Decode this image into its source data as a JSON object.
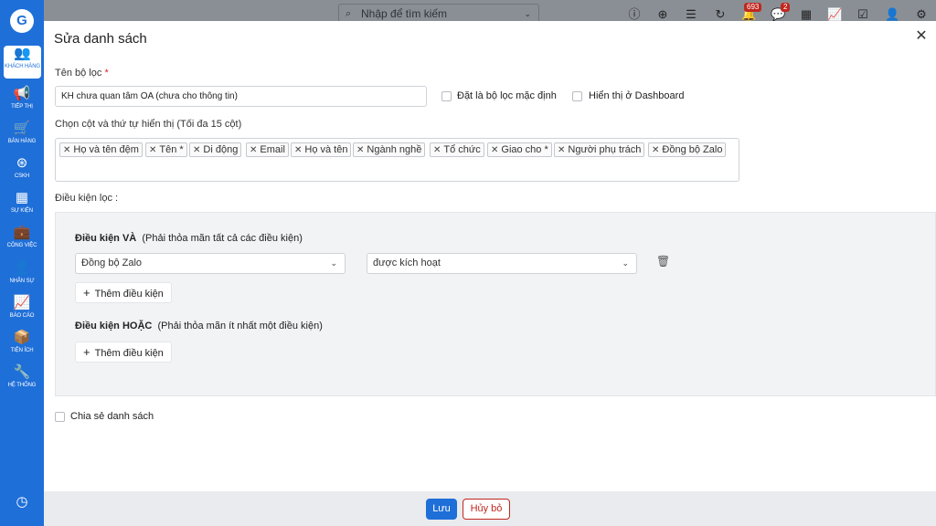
{
  "sidebar": {
    "logo": "G",
    "items": [
      {
        "label": "KHÁCH HÀNG",
        "icon": "users-icon",
        "glyph": "👥"
      },
      {
        "label": "TIẾP THỊ",
        "icon": "megaphone-icon",
        "glyph": "📢"
      },
      {
        "label": "BÁN HÀNG",
        "icon": "cart-icon",
        "glyph": "🛒"
      },
      {
        "label": "CSKH",
        "icon": "lifebuoy-icon",
        "glyph": "⊛"
      },
      {
        "label": "SỰ KIỆN",
        "icon": "calendar-icon",
        "glyph": "▦"
      },
      {
        "label": "CÔNG VIỆC",
        "icon": "briefcase-icon",
        "glyph": "💼"
      },
      {
        "label": "NHÂN SỰ",
        "icon": "person-icon",
        "glyph": "👤"
      },
      {
        "label": "BÁO CÁO",
        "icon": "report-icon",
        "glyph": "📈"
      },
      {
        "label": "TIỆN ÍCH",
        "icon": "boxes-icon",
        "glyph": "📦"
      },
      {
        "label": "HỆ THỐNG",
        "icon": "wrench-icon",
        "glyph": "🔧"
      }
    ],
    "clock_glyph": "◷"
  },
  "topbar": {
    "search_placeholder": "Nhập để tìm kiếm",
    "notifications_badge": "693",
    "messages_badge": "2"
  },
  "modal": {
    "title": "Sửa danh sách",
    "close_glyph": "✕",
    "filter_name_label": "Tên bộ lọc",
    "required_mark": "*",
    "filter_name_value": "KH chưa quan tâm OA (chưa cho thông tin)",
    "default_filter_label": "Đặt là bộ lọc mặc định",
    "dashboard_label": "Hiển thị ở Dashboard",
    "columns_label": "Chọn cột và thứ tự hiển thị (Tối đa 15 cột)",
    "columns": [
      "Họ và tên đệm",
      "Tên *",
      "Di động",
      "Email",
      "Họ và tên",
      "Ngành nghề",
      "Tổ chức",
      "Giao cho *",
      "Người phụ trách",
      "Đồng bộ Zalo"
    ],
    "conditions_label": "Điều kiện lọc :",
    "and_group": {
      "title": "Điều kiện VÀ",
      "hint": "(Phải thỏa mãn tất cả các điều kiện)",
      "field": "Đồng bộ Zalo",
      "value": "được kích hoạt",
      "add_label": "Thêm điều kiện"
    },
    "or_group": {
      "title": "Điều kiện HOẶC",
      "hint": "(Phải thỏa mãn ít nhất một điều kiện)",
      "add_label": "Thêm điều kiện"
    },
    "share_label": "Chia sẻ danh sách",
    "save_label": "Lưu",
    "cancel_label": "Hủy bỏ"
  }
}
